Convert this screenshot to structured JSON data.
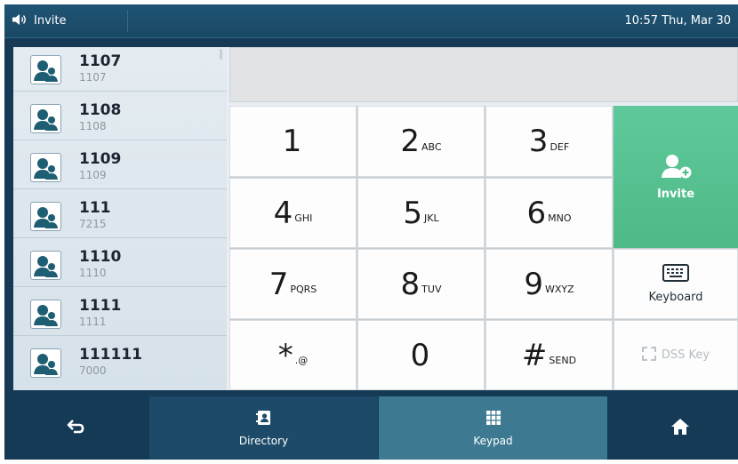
{
  "status": {
    "title": "Invite",
    "time": "10:57 Thu, Mar 30",
    "icon": "speaker-icon"
  },
  "contacts": [
    {
      "name": "1107",
      "number": "1107"
    },
    {
      "name": "1108",
      "number": "1108"
    },
    {
      "name": "1109",
      "number": "1109"
    },
    {
      "name": "111",
      "number": "7215"
    },
    {
      "name": "1110",
      "number": "1110"
    },
    {
      "name": "1111",
      "number": "1111"
    },
    {
      "name": "111111",
      "number": "7000"
    }
  ],
  "dial_input": {
    "value": ""
  },
  "keypad": {
    "k1": {
      "main": "1",
      "sub": ""
    },
    "k2": {
      "main": "2",
      "sub": "ABC"
    },
    "k3": {
      "main": "3",
      "sub": "DEF"
    },
    "k4": {
      "main": "4",
      "sub": "GHI"
    },
    "k5": {
      "main": "5",
      "sub": "JKL"
    },
    "k6": {
      "main": "6",
      "sub": "MNO"
    },
    "k7": {
      "main": "7",
      "sub": "PQRS"
    },
    "k8": {
      "main": "8",
      "sub": "TUV"
    },
    "k9": {
      "main": "9",
      "sub": "WXYZ"
    },
    "kstar": {
      "main": "*",
      "sub": ".@"
    },
    "k0": {
      "main": "0",
      "sub": ""
    },
    "khash": {
      "main": "#",
      "sub": "SEND"
    }
  },
  "actions": {
    "invite": "Invite",
    "keyboard": "Keyboard",
    "dss_key": "DSS Key"
  },
  "nav": {
    "directory": "Directory",
    "keypad": "Keypad"
  },
  "colors": {
    "invite_green": "#57c290",
    "active_tab": "#3d7a92",
    "status_bar": "#1c4d6b"
  }
}
